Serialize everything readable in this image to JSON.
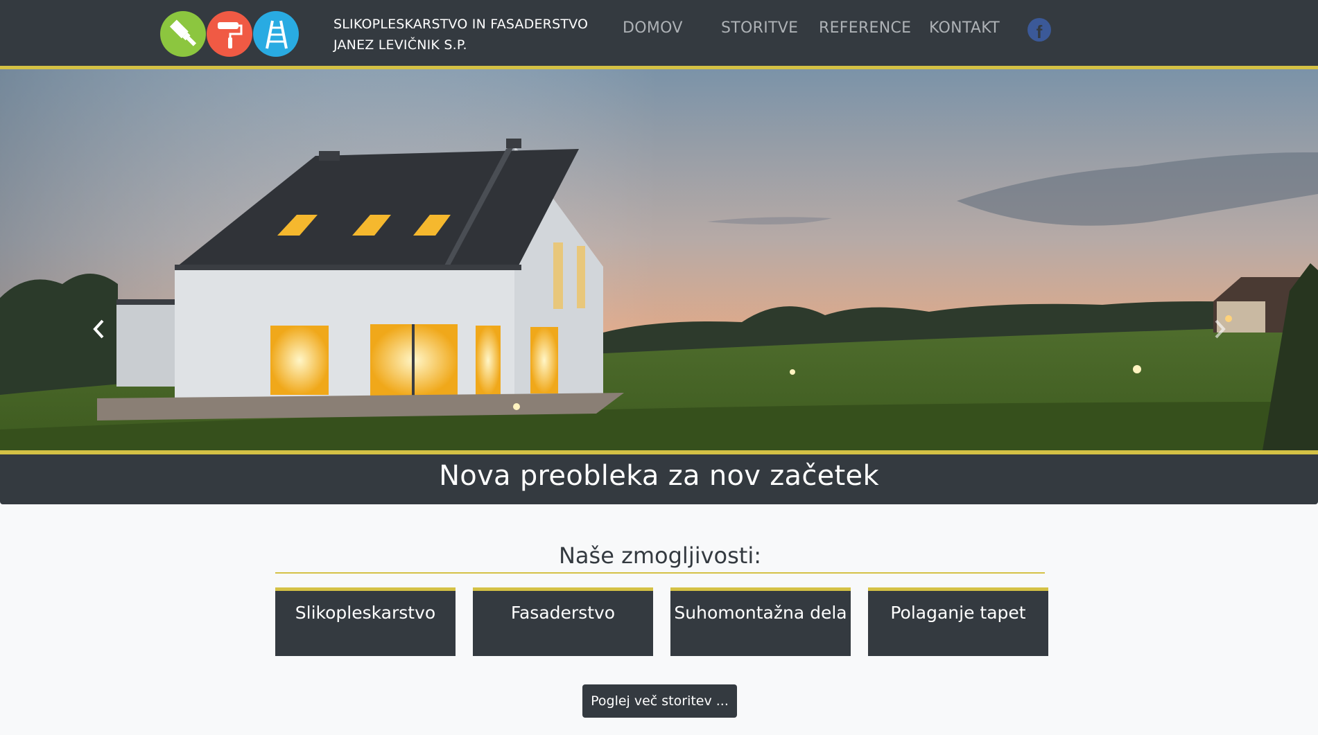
{
  "header": {
    "brand_line1": "SLIKOPLESKARSTVO IN FASADERSTVO",
    "brand_line2": "JANEZ LEVIČNIK S.P.",
    "nav": [
      {
        "label": "DOMOV"
      },
      {
        "label": "STORITVE"
      },
      {
        "label": "REFERENCE"
      },
      {
        "label": "KONTAKT"
      }
    ],
    "facebook_glyph": "f",
    "logo_icons": [
      "paint-brush-icon",
      "paint-roller-icon",
      "ladder-icon"
    ]
  },
  "hero": {
    "caption": "Nova preobleka za nov začetek",
    "controls": [
      "chevron-left-icon",
      "chevron-right-icon"
    ]
  },
  "capabilities": {
    "title": "Naše zmogljivosti:",
    "cards": [
      {
        "label": "Slikopleskarstvo"
      },
      {
        "label": "Fasaderstvo"
      },
      {
        "label": "Suhomontažna dela"
      },
      {
        "label": "Polaganje tapet"
      }
    ],
    "more_button": "Poglej več storitev ..."
  },
  "colors": {
    "dark": "#343a40",
    "accent": "#d4c145",
    "logo_green": "#8cc63f",
    "logo_red": "#f05a44",
    "logo_blue": "#29abe2",
    "facebook": "#3b5998"
  }
}
